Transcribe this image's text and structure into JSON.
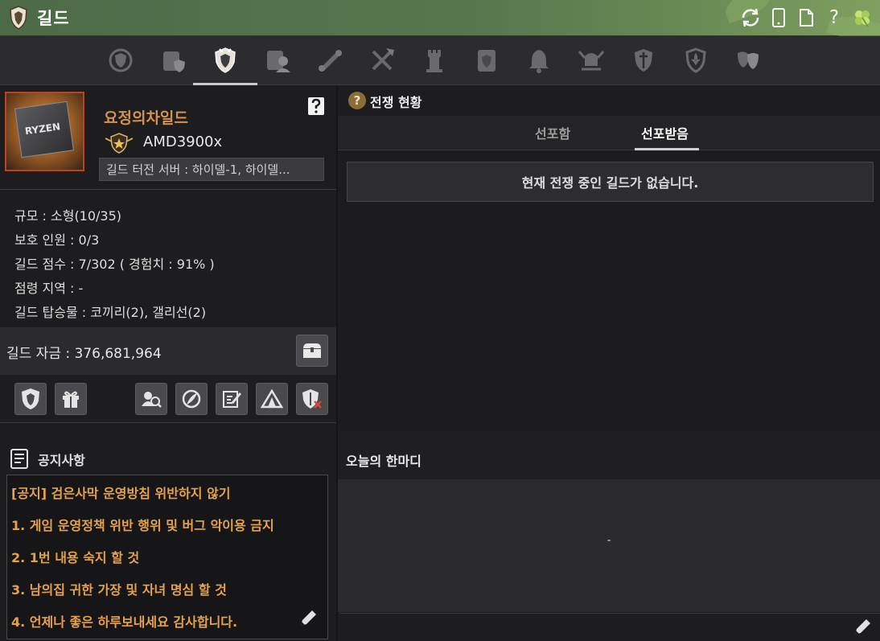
{
  "window": {
    "title": "길드",
    "controls": [
      "refresh-icon",
      "phone-icon",
      "document-icon",
      "help-icon",
      "clover-icon"
    ],
    "help_glyph": "?"
  },
  "tabs": {
    "items": [
      "emblem-icon",
      "scroll-shield-icon",
      "crest-icon",
      "member-scroll-icon",
      "quest-scroll-icon",
      "crossed-weapons-icon",
      "tower-icon",
      "map-shield-icon",
      "bell-icon",
      "horned-helmet-icon",
      "sword-shield-icon",
      "fleur-shield-icon",
      "masks-icon"
    ],
    "active_index": 2
  },
  "profile": {
    "avatar_text": "RYZEN",
    "guild_name": "요정의차일드",
    "leader_name": "AMD3900x",
    "server": "길드 터전 서버 : 하이델-1, 하이델..."
  },
  "stats": {
    "size": "규모 : 소형(10/35)",
    "protect": "보호 인원 : 0/3",
    "score": "길드 점수 : 7/302 ( 경험치 : 91% )",
    "occupation": "점령 지역 : -",
    "vehicles": "길드 탑승물 : 코끼리(2), 갤리선(2)"
  },
  "funds": {
    "label": "길드 자금 : 376,681,964"
  },
  "actions": [
    "guild-crest-icon",
    "gift-icon",
    "search-members-icon",
    "no-entry-icon",
    "write-icon",
    "tent-icon",
    "shield-x-icon"
  ],
  "notice": {
    "title": "공지사항",
    "lines": [
      "[공지] 검은사막 운영방침 위반하지 않기",
      "1. 게임 운영정책 위반 행위 및 버그 악이용 금지",
      "2. 1번 내용 숙지 할 것",
      "3. 남의집 귀한 가장 및 자녀 명심 할 것",
      "4. 언제나 좋은 하루보내세요 감사합니다."
    ]
  },
  "war": {
    "help_glyph": "?",
    "title": "전쟁 현황",
    "tabs": [
      "선포함",
      "선포받음"
    ],
    "active_tab": 1,
    "empty_message": "현재 전쟁 중인 길드가 없습니다."
  },
  "today_word": {
    "title": "오늘의 한마디",
    "text": "-"
  },
  "colors": {
    "accent_orange": "#e6a24a",
    "guild_name": "#d4924a",
    "titlebar_green": "#58774e"
  }
}
